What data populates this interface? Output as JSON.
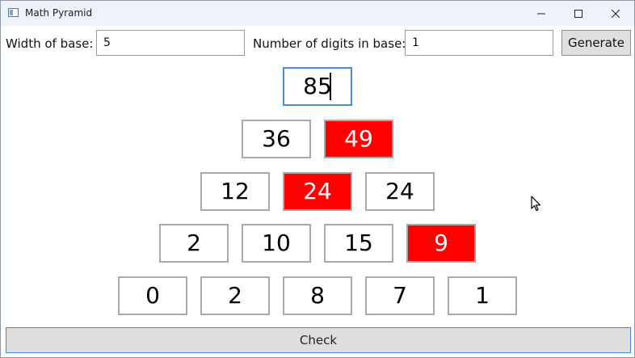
{
  "window": {
    "title": "Math Pyramid",
    "icon": "app-window-icon",
    "controls": [
      "minimize-icon",
      "maximize-icon",
      "close-icon"
    ]
  },
  "settings": {
    "width_label": "Width of base:",
    "width_value": "5",
    "digits_label": "Number of digits in base:",
    "digits_value": "1",
    "generate_label": "Generate"
  },
  "pyramid": {
    "rows": [
      [
        {
          "value": "85",
          "state": "focused"
        }
      ],
      [
        {
          "value": "36",
          "state": "normal"
        },
        {
          "value": "49",
          "state": "wrong"
        }
      ],
      [
        {
          "value": "12",
          "state": "normal"
        },
        {
          "value": "24",
          "state": "wrong"
        },
        {
          "value": "24",
          "state": "normal"
        }
      ],
      [
        {
          "value": "2",
          "state": "normal"
        },
        {
          "value": "10",
          "state": "normal"
        },
        {
          "value": "15",
          "state": "normal"
        },
        {
          "value": "9",
          "state": "wrong"
        }
      ],
      [
        {
          "value": "0",
          "state": "normal"
        },
        {
          "value": "2",
          "state": "normal"
        },
        {
          "value": "8",
          "state": "normal"
        },
        {
          "value": "7",
          "state": "normal"
        },
        {
          "value": "1",
          "state": "normal"
        }
      ]
    ]
  },
  "check_label": "Check",
  "colors": {
    "wrong_bg": "#ff0000",
    "wrong_text": "#ffffff",
    "focus_border": "#4a8fd6",
    "cell_border": "#a9a9a9"
  }
}
